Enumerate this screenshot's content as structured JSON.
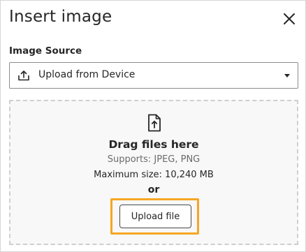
{
  "dialog": {
    "title": "Insert image",
    "close_icon": "close-icon"
  },
  "image_source": {
    "label": "Image Source",
    "selected": "Upload from Device",
    "icon": "upload-icon"
  },
  "dropzone": {
    "icon": "upload-document-icon",
    "title": "Drag files here",
    "supports": "Supports: JPEG, PNG",
    "max_size": "Maximum size: 10,240 MB",
    "or_text": "or",
    "button_label": "Upload file"
  },
  "colors": {
    "focus_ring": "#f5a623",
    "text": "#262626",
    "muted": "#6b6b6b",
    "dropzone_bg": "#f8f8f8"
  }
}
